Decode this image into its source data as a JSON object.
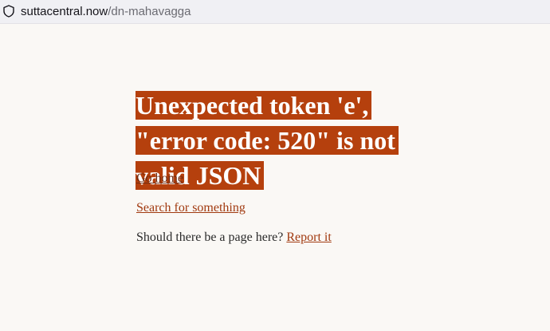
{
  "browser": {
    "url_host": "suttacentral.now",
    "url_path": "/dn-mahavagga",
    "icon": "shield-icon"
  },
  "error": {
    "title": "Unexpected token 'e', \"error code: 520\" is not valid JSON",
    "accent_color": "#b5400d"
  },
  "links": {
    "home": "Go home",
    "search": "Search for something",
    "report_prompt": "Should there be a page here?",
    "report": "Report it"
  }
}
